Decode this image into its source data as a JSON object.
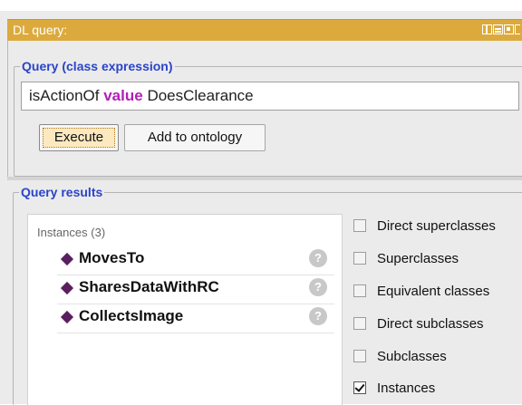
{
  "window": {
    "title": "DL query:"
  },
  "query": {
    "section_title": "Query (class expression)",
    "expression_parts": [
      "isActionOf",
      "value",
      "DoesClearance"
    ],
    "execute_label": "Execute",
    "add_label": "Add to ontology"
  },
  "results": {
    "section_title": "Query results",
    "instances_header": "Instances (3)",
    "instances": [
      {
        "label": "MovesTo",
        "help": "?"
      },
      {
        "label": "SharesDataWithRC",
        "help": "?"
      },
      {
        "label": "CollectsImage",
        "help": "?"
      }
    ],
    "options": [
      {
        "label": "Direct superclasses",
        "checked": false
      },
      {
        "label": "Superclasses",
        "checked": false
      },
      {
        "label": "Equivalent classes",
        "checked": false
      },
      {
        "label": "Direct subclasses",
        "checked": false
      },
      {
        "label": "Subclasses",
        "checked": false
      },
      {
        "label": "Instances",
        "checked": true
      }
    ]
  },
  "colors": {
    "title_bar": "#dcaa3c",
    "section_title": "#2a44c8",
    "keyword": "#b21fb6",
    "instance_diamond": "#5a1f5e"
  }
}
